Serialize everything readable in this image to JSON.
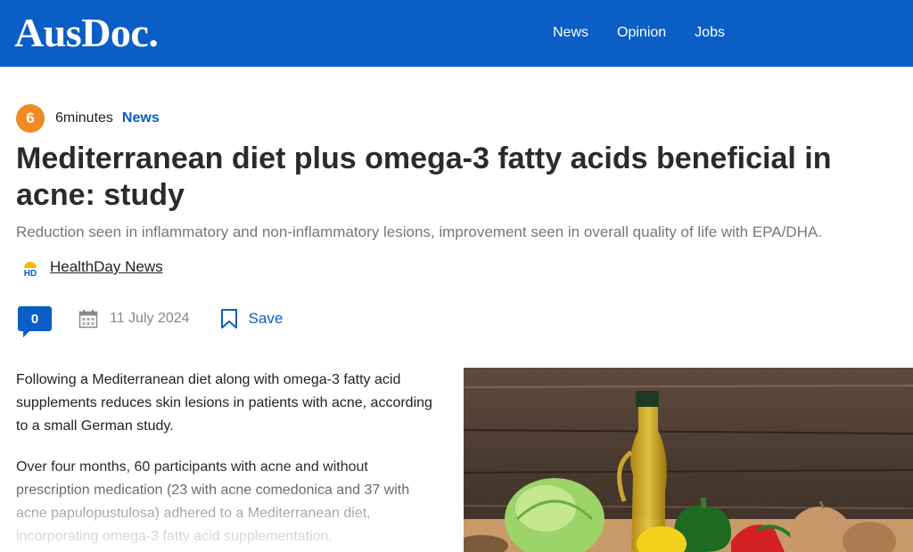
{
  "header": {
    "logo": "AusDoc.",
    "nav": [
      "News",
      "Opinion",
      "Jobs"
    ]
  },
  "article": {
    "read_minutes": "6",
    "read_label": "6minutes",
    "category": "News",
    "title": "Mediterranean diet plus omega-3 fatty acids beneficial in acne: study",
    "subtitle": "Reduction seen in inflammatory and non-inflammatory lesions, improvement seen in overall quality of life with EPA/DHA.",
    "source": {
      "logo_text": "HD",
      "name": "HealthDay News"
    },
    "comment_count": "0",
    "date": "11 July 2024",
    "save_label": "Save",
    "paragraphs": [
      "Following a Mediterranean diet along with omega-3 fatty acid supplements reduces skin lesions in patients with acne, according to a small German study.",
      "Over four months, 60 participants with acne and without prescription medication (23 with acne comedonica and 37 with acne papulopustulosa) adhered to a Mediterranean diet, incorporating omega-3 fatty acid supplementation."
    ]
  },
  "icons": {
    "calendar": "calendar-icon",
    "bookmark": "bookmark-icon",
    "comment": "comment-icon"
  },
  "colors": {
    "brand_blue": "#0a5ec6",
    "badge_orange": "#f08a24"
  }
}
